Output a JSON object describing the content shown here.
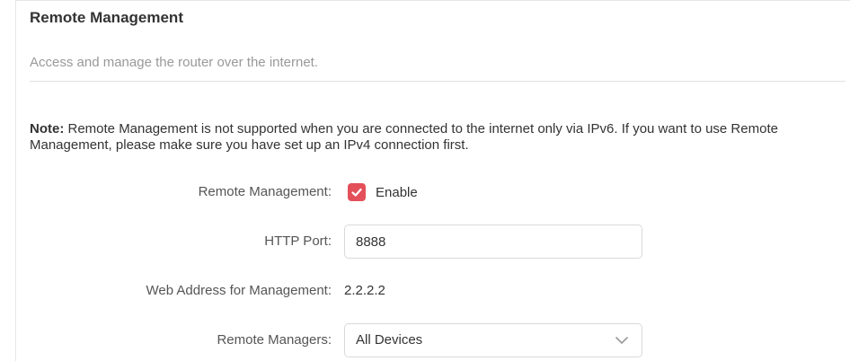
{
  "section": {
    "title": "Remote Management",
    "subtitle": "Access and manage the router over the internet."
  },
  "note": {
    "prefix": "Note:",
    "text": "Remote Management is not supported when you are connected to the internet only via IPv6. If you want to use Remote Management, please make sure you have set up an IPv4 connection first."
  },
  "form": {
    "remote_management": {
      "label": "Remote Management:",
      "checkbox_label": "Enable",
      "checked": true
    },
    "http_port": {
      "label": "HTTP Port:",
      "value": "8888"
    },
    "web_address": {
      "label": "Web Address for Management:",
      "value": "2.2.2.2"
    },
    "remote_managers": {
      "label": "Remote Managers:",
      "selected": "All Devices"
    }
  },
  "colors": {
    "accent": "#e4505a",
    "muted_text": "#999999",
    "border": "#d9d9d9"
  },
  "icons": {
    "checkbox": "checkmark-icon",
    "dropdown": "chevron-down-icon"
  }
}
